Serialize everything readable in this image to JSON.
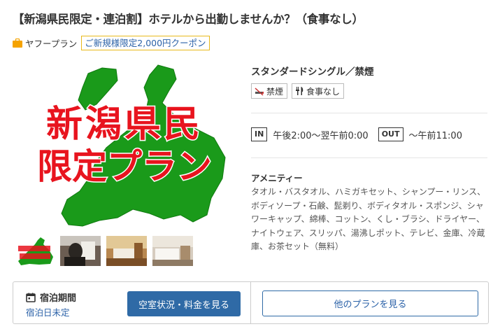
{
  "plan": {
    "title": "【新潟県民限定・連泊割】ホテルから出勤しませんか？（食事なし）",
    "badge_label": "ヤフープラン",
    "coupon_label": "ご新規様限定2,000円クーポン"
  },
  "main_image": {
    "text_line1": "新潟県民",
    "text_line2": "限定プラン"
  },
  "room": {
    "name": "スタンダードシングル／禁煙",
    "tags": [
      "禁煙",
      "食事なし"
    ]
  },
  "checkin": {
    "in_label": "IN",
    "in_time": "午後2:00〜翌午前0:00",
    "out_label": "OUT",
    "out_time": "〜午前11:00"
  },
  "amenities": {
    "title": "アメニティー",
    "text": "タオル・バスタオル、ハミガキセット、シャンプー・リンス、ボディソープ・石鹸、髭剃り、ボディタオル・スポンジ、シャワーキャップ、綿棒、コットン、くし・ブラシ、ドライヤー、ナイトウェア、スリッパ、湯沸しポット、テレビ、金庫、冷蔵庫、お茶セット（無料）"
  },
  "booking": {
    "period_label": "宿泊期間",
    "period_value": "宿泊日未定",
    "primary_button": "空室状況・料金を見る",
    "secondary_button": "他のプランを見る"
  },
  "colors": {
    "accent_blue": "#2f6aa6",
    "map_green": "#1a9a1a",
    "promo_red": "#e8141e",
    "coupon_border": "#e8b81a"
  }
}
